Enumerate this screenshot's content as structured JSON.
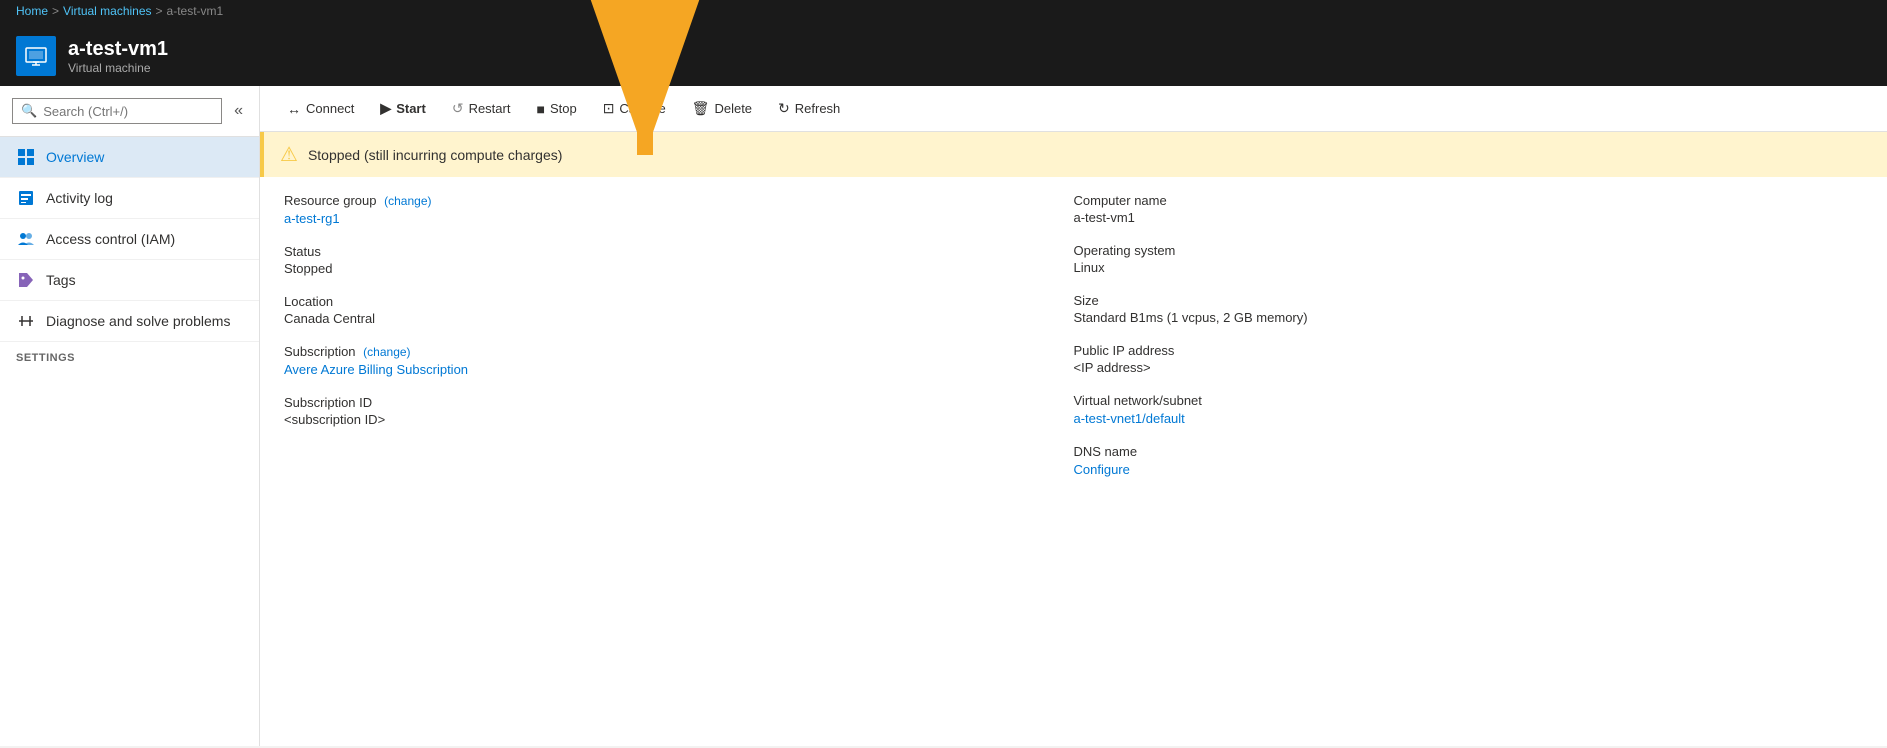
{
  "breadcrumb": {
    "home": "Home",
    "separator1": ">",
    "vms": "Virtual machines",
    "separator2": ">",
    "current": "a-test-vm1"
  },
  "header": {
    "title": "a-test-vm1",
    "subtitle": "Virtual machine"
  },
  "search": {
    "placeholder": "Search (Ctrl+/)"
  },
  "nav": {
    "items": [
      {
        "id": "overview",
        "label": "Overview",
        "active": true
      },
      {
        "id": "activity-log",
        "label": "Activity log",
        "active": false
      },
      {
        "id": "access-control",
        "label": "Access control (IAM)",
        "active": false
      },
      {
        "id": "tags",
        "label": "Tags",
        "active": false
      },
      {
        "id": "diagnose",
        "label": "Diagnose and solve problems",
        "active": false
      }
    ],
    "sections": [
      {
        "id": "settings",
        "label": "SETTINGS"
      }
    ]
  },
  "toolbar": {
    "buttons": [
      {
        "id": "connect",
        "label": "Connect",
        "icon": "↔"
      },
      {
        "id": "start",
        "label": "Start",
        "icon": "▶"
      },
      {
        "id": "restart",
        "label": "Restart",
        "icon": "↺"
      },
      {
        "id": "stop",
        "label": "Stop",
        "icon": "■"
      },
      {
        "id": "capture",
        "label": "Capture",
        "icon": "⊡"
      },
      {
        "id": "delete",
        "label": "Delete",
        "icon": "🗑"
      },
      {
        "id": "refresh",
        "label": "Refresh",
        "icon": "↻"
      }
    ]
  },
  "warning": {
    "message": "Stopped (still incurring compute charges)"
  },
  "details": {
    "left": [
      {
        "id": "resource-group",
        "label": "Resource group",
        "hasChange": true,
        "changeText": "(change)",
        "value": "a-test-rg1",
        "isLink": true
      },
      {
        "id": "status",
        "label": "Status",
        "value": "Stopped",
        "isLink": false
      },
      {
        "id": "location",
        "label": "Location",
        "value": "Canada Central",
        "isLink": false
      },
      {
        "id": "subscription",
        "label": "Subscription",
        "hasChange": true,
        "changeText": "(change)",
        "value": "Avere Azure Billing Subscription",
        "isLink": true
      },
      {
        "id": "subscription-id",
        "label": "Subscription ID",
        "value": "<subscription ID>",
        "isLink": false
      }
    ],
    "right": [
      {
        "id": "computer-name",
        "label": "Computer name",
        "value": "a-test-vm1",
        "isLink": false
      },
      {
        "id": "operating-system",
        "label": "Operating system",
        "value": "Linux",
        "isLink": false
      },
      {
        "id": "size",
        "label": "Size",
        "value": "Standard B1ms (1 vcpus, 2 GB memory)",
        "isLink": false
      },
      {
        "id": "public-ip",
        "label": "Public IP address",
        "value": "<IP address>",
        "isLink": false
      },
      {
        "id": "vnet-subnet",
        "label": "Virtual network/subnet",
        "value": "a-test-vnet1/default",
        "isLink": true
      },
      {
        "id": "dns-name",
        "label": "DNS name",
        "value": "Configure",
        "isLink": true
      }
    ]
  },
  "arrow": {
    "visible": true
  }
}
